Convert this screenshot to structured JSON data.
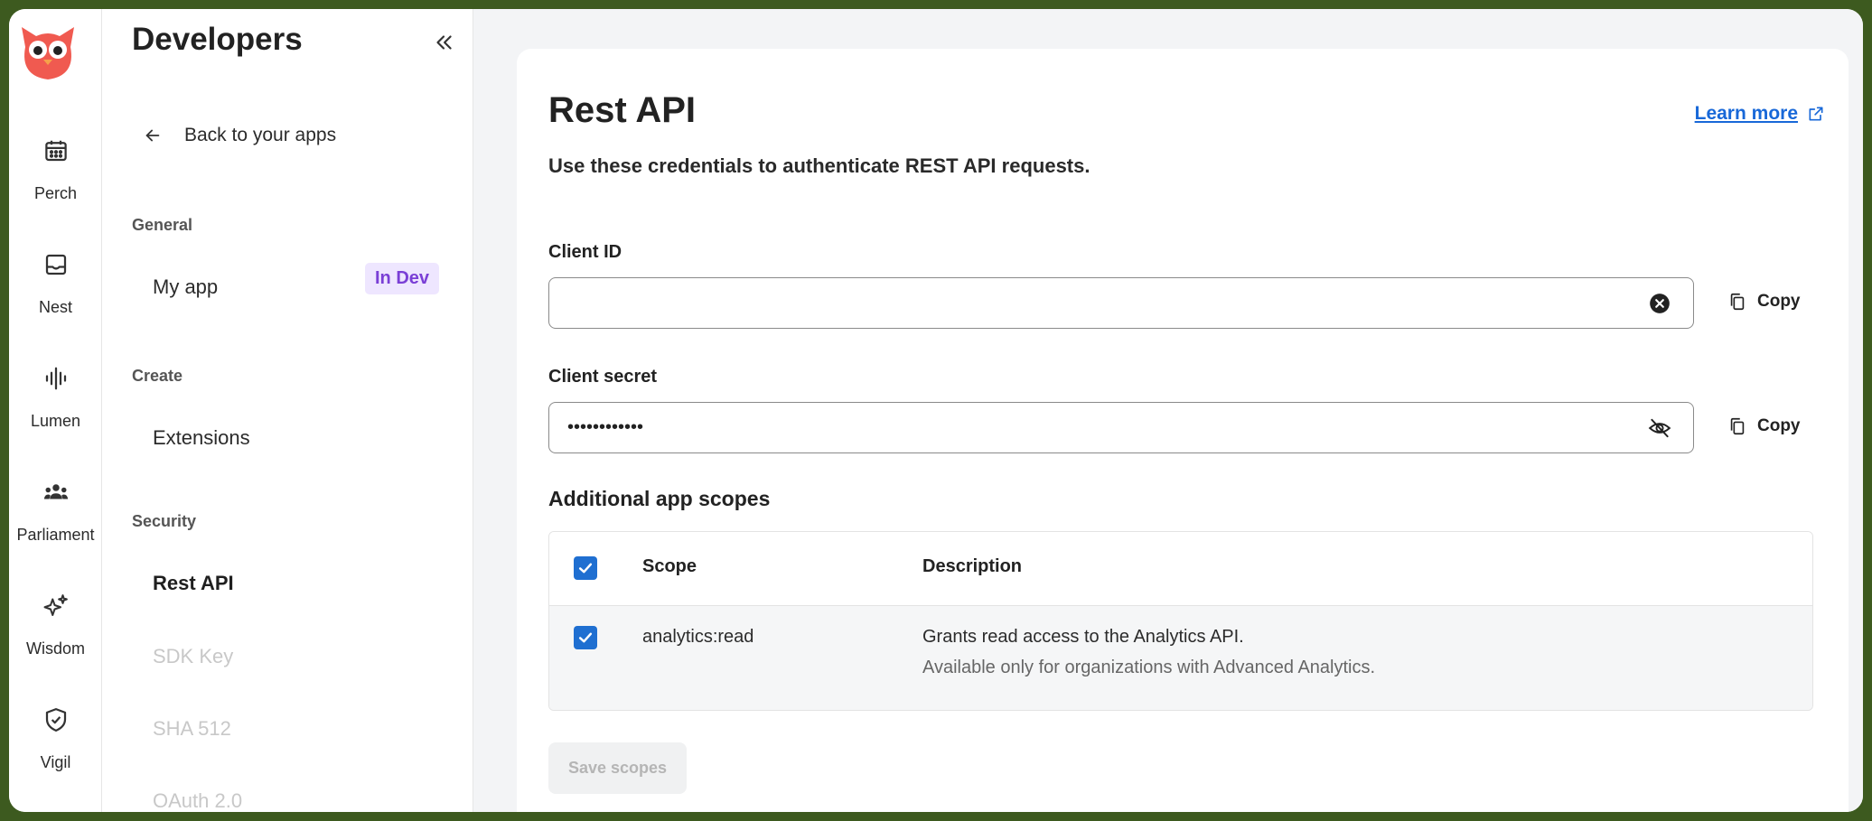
{
  "rail": {
    "items": [
      {
        "label": "Perch",
        "icon": "calendar-icon"
      },
      {
        "label": "Nest",
        "icon": "inbox-icon"
      },
      {
        "label": "Lumen",
        "icon": "waveform-icon"
      },
      {
        "label": "Parliament",
        "icon": "team-icon"
      },
      {
        "label": "Wisdom",
        "icon": "sparkles-icon"
      },
      {
        "label": "Vigil",
        "icon": "shield-check-icon"
      }
    ]
  },
  "sidebar": {
    "title": "Developers",
    "back_label": "Back to your apps",
    "general_heading": "General",
    "my_app_label": "My app",
    "my_app_badge": "In Dev",
    "create_heading": "Create",
    "extensions_label": "Extensions",
    "security_heading": "Security",
    "rest_api_label": "Rest API",
    "sdk_key_label": "SDK Key",
    "sha512_label": "SHA 512",
    "oauth_label": "OAuth 2.0"
  },
  "main": {
    "title": "Rest API",
    "learn_more": "Learn more",
    "subtitle": "Use these credentials to authenticate REST API requests.",
    "client_id": {
      "label": "Client ID",
      "value": ""
    },
    "client_secret": {
      "label": "Client secret",
      "value": "••••••••••••"
    },
    "copy_label": "Copy",
    "scopes_title": "Additional app scopes",
    "table": {
      "headers": {
        "scope": "Scope",
        "description": "Description"
      },
      "rows": [
        {
          "scope": "analytics:read",
          "description": "Grants read access to the Analytics API.",
          "note": "Available only for organizations with Advanced Analytics."
        }
      ]
    },
    "save_label": "Save scopes"
  },
  "colors": {
    "accent": "#1f6fd1",
    "link": "#1868d8",
    "badge_bg": "#eee6ff",
    "badge_text": "#7a3fd6",
    "logo": "#f05a50"
  }
}
